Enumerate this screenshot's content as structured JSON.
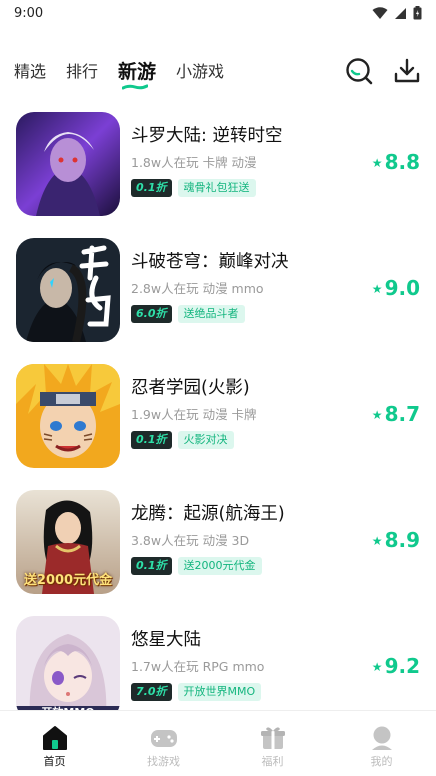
{
  "status_bar": {
    "time": "9:00"
  },
  "top_nav": {
    "tabs": [
      {
        "label": "精选"
      },
      {
        "label": "排行"
      },
      {
        "label": "新游"
      },
      {
        "label": "小游戏"
      }
    ],
    "active_tab": "新游",
    "icons": [
      "search-icon",
      "download-icon"
    ]
  },
  "games": [
    {
      "title": "斗罗大陆: 逆转时空",
      "meta": "1.8w人在玩  卡牌  动漫",
      "discount": "0.1折",
      "tag": "魂骨礼包狂送",
      "score": "8.8"
    },
    {
      "title": "斗破苍穹：巅峰对决",
      "meta": "2.8w人在玩  动漫  mmo",
      "discount": "6.0折",
      "tag": "送绝品斗者",
      "score": "9.0"
    },
    {
      "title": "忍者学园(火影)",
      "meta": "1.9w人在玩  动漫  卡牌",
      "discount": "0.1折",
      "tag": "火影对决",
      "score": "8.7"
    },
    {
      "title": "龙腾：起源(航海王)",
      "meta": "3.8w人在玩  动漫  3D",
      "discount": "0.1折",
      "tag": "送2000元代金",
      "score": "8.9",
      "thumb_text": "送2000元代金"
    },
    {
      "title": "悠星大陆",
      "meta": "1.7w人在玩  RPG  mmo",
      "discount": "7.0折",
      "tag": "开放世界MMO",
      "score": "9.2",
      "thumb_text": "开放MMO"
    }
  ],
  "bottom_nav": {
    "items": [
      {
        "label": "首页",
        "icon": "home-icon"
      },
      {
        "label": "找游戏",
        "icon": "gamepad-icon"
      },
      {
        "label": "福利",
        "icon": "gift-icon"
      },
      {
        "label": "我的",
        "icon": "user-icon"
      }
    ],
    "active": "首页"
  },
  "colors": {
    "accent": "#10c98d",
    "tag_bg": "#dcf7ee",
    "discount_bg": "#1e2a2a"
  }
}
